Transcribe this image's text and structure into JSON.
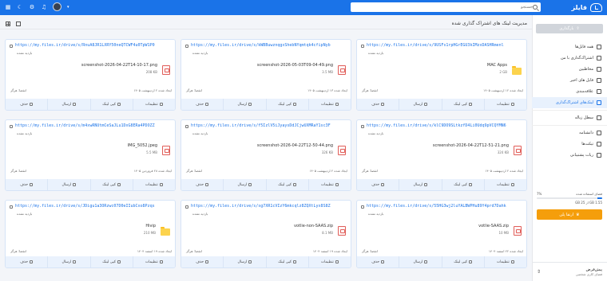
{
  "header": {
    "logo_text": "فایلز",
    "search_placeholder": "جستجو"
  },
  "main": {
    "page_title": "مدیریت لینک های اشتراک گذاری شده"
  },
  "sidebar": {
    "upload_label": "بارگذاری",
    "items": [
      {
        "label": "همه فایل‌ها"
      },
      {
        "label": "اشتراک‌گذاری با من"
      },
      {
        "label": "مخاطبین"
      },
      {
        "label": "فایل های اخیر"
      },
      {
        "label": "علاقه‌مندی"
      },
      {
        "label": "لینک‌های اشتراک‌گذاری"
      },
      {
        "label": "سطل زباله"
      },
      {
        "label": "دانشنامه"
      },
      {
        "label": "تیکت‌ها"
      },
      {
        "label": "ربات پشتیبانی"
      }
    ],
    "quota_title": "فضای استفاده شده",
    "quota_percent_text": "7%",
    "quota_percent": 0.07,
    "quota_detail": "1.55 GB از 25 GB",
    "upgrade_label": "ارتقا پلن",
    "profile_name": "پیش‌فرض",
    "profile_sub": "فضای کاری شخصی"
  },
  "common": {
    "not_visited": "بازدید نشده",
    "actions": {
      "settings": "تنظیمات",
      "copy": "کپی لینک",
      "send": "ارسال",
      "delete": "حذف"
    }
  },
  "cards": [
    {
      "url": "https://my.files.ir/drive/s/9USFs1rpHGrEGU3kIMzxDASHRmenl",
      "sub_right": "1 بازدید",
      "file_name": "MAC Apps",
      "file_size": "2 GB",
      "file_type": "folder",
      "created": "ایجاد شده ۱۲ اردیبهشت ۱۴۰۵",
      "expiry": "انقضا: هرگز"
    },
    {
      "url": "https://my.files.ir/drive/s/kWBBuwznqgxShebNYqmtqk4cfipNyb",
      "sub_right": "1 بازدید",
      "file_name": "screenshot-2026-05-03T09-04-49.png",
      "file_size": "3.5 MB",
      "file_type": "pdf",
      "created": "ایجاد شده ۱۳ اردیبهشت ۱۴۰۵",
      "expiry": "انقضا: هرگز"
    },
    {
      "url": "https://my.files.ir/drive/s/RnuA8JR1LXRY50neQTCWF4u0TpW1P0",
      "sub_right": "1 بازدید",
      "file_name": "screenshot-2026-04-22T14-10-17.png",
      "file_size": "208 KB",
      "file_type": "pdf",
      "created": "ایجاد شده ۲ اردیبهشت ۱۴۰۵",
      "expiry": "انقضا: هرگز"
    },
    {
      "url": "https://my.files.ir/drive/s/klC9DO9SLtkzfD4Li0Udq9pVCQYMN6",
      "sub_right": "",
      "file_name": "screenshot-2026-04-22T12-51-21.png",
      "file_size": "324 KB",
      "file_type": "pdf",
      "created": "ایجاد شده ۲ اردیبهشت ۱۴۰۵",
      "expiry": "انقضا: هرگز"
    },
    {
      "url": "https://my.files.ir/drive/s/f5IzlV5iJyaysDdJCjwUXMRaY1sc3F",
      "sub_right": "",
      "file_name": "screenshot-2026-04-22T12-50-44.png",
      "file_size": "326 KB",
      "file_type": "pdf",
      "created": "ایجاد شده ۲ اردیبهشت ۱۴۰۵",
      "expiry": "انقضا: هرگز"
    },
    {
      "url": "https://my.files.ir/drive/s/m4xwRNUtmCeSaJLu1DxG8ERa4PDOZZ",
      "sub_right": "https://zaya.ir/eofg",
      "file_name": "IMG_5052.jpeg",
      "file_size": "5.5 MB",
      "file_type": "pdf",
      "created": "ایجاد شده ۲۸ فروردین ۱۴۰۵",
      "expiry": "انقضا: هرگز"
    },
    {
      "url": "https://my.files.ir/drive/s/55HG3wj2luYALBWPHu89Y4prd7Dahk",
      "sub_right": "https://go.files.ir/2znj1",
      "file_name": "votlie-SAAS.zip",
      "file_size": "10 MB",
      "file_type": "pdf",
      "created": "ایجاد شده ۲۲ اسفند ۱۴۰۴",
      "expiry": "انقضا: هرگز"
    },
    {
      "url": "https://my.files.ir/drive/s/sg7XR1cVIzY6mkcqlz8ZQXtLyx8S8Z",
      "sub_right": "https://go.files.ir/dbnni",
      "file_name": "votlie-non-SAAS.zip",
      "file_size": "8.1 MB",
      "file_type": "pdf",
      "created": "ایجاد شده ۱۹ اسفند ۱۴۰۴",
      "expiry": "انقضا: هرگز"
    },
    {
      "url": "https://my.files.ir/drive/s/JDigu1a3ORzwc07D0eIIubCxo8Pzqs",
      "sub_right": "https://go.files.ir/jlbwq2",
      "file_name": "Hivip",
      "file_size": "210 MB",
      "file_type": "folder",
      "created": "ایجاد شده ۱۹ اسفند ۱۴۰۴",
      "expiry": "انقضا: هرگز"
    }
  ]
}
